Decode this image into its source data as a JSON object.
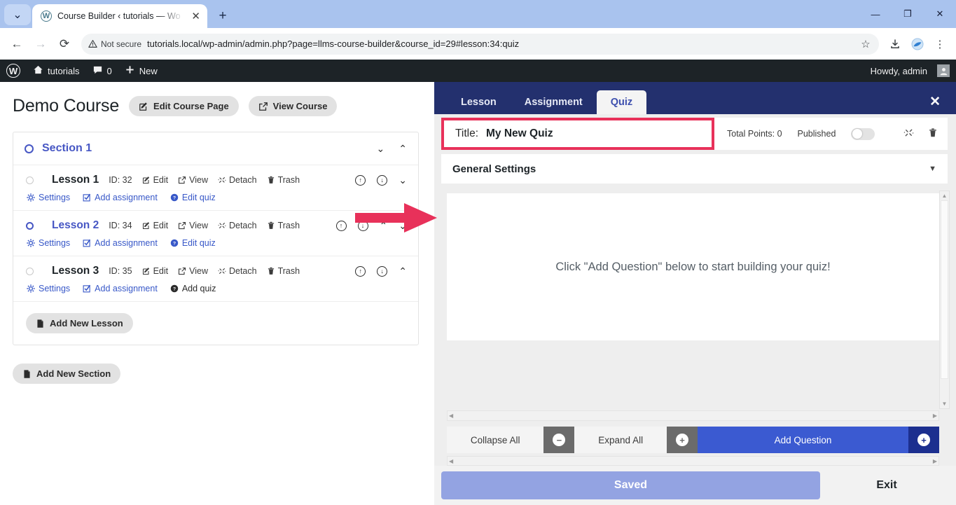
{
  "browser": {
    "tab": {
      "title": "Course Builder ‹ tutorials — Wo",
      "favicon": "wordpress-icon",
      "close": "✕"
    },
    "new_tab_label": "+",
    "tab_search": "⌄",
    "window_controls": {
      "minimize": "—",
      "maximize": "❐",
      "close": "✕"
    },
    "nav": {
      "back": "←",
      "forward": "→",
      "reload": "⟳"
    },
    "security_label": "Not secure",
    "url": "tutorials.local/wp-admin/admin.php?page=llms-course-builder&course_id=29#lesson:34:quiz",
    "toolbar_icons": {
      "bookmark": "☆",
      "downloads": "download-icon",
      "extension": "extension-icon",
      "menu": "⋮"
    }
  },
  "wp_adminbar": {
    "logo": "W",
    "site_name": "tutorials",
    "comments_count": "0",
    "new_label": "New",
    "howdy": "Howdy, admin"
  },
  "course": {
    "title": "Demo Course",
    "edit_course_page": "Edit Course Page",
    "view_course": "View Course",
    "add_new_section": "Add New Section",
    "add_new_lesson": "Add New Lesson",
    "section": {
      "name": "Section 1",
      "expand_icon": "⌄",
      "collapse_icon": "⌃"
    },
    "lessons": [
      {
        "name": "Lesson 1",
        "id_label": "ID: 32",
        "edit": "Edit",
        "view": "View",
        "detach": "Detach",
        "trash": "Trash",
        "settings": "Settings",
        "add_assignment": "Add assignment",
        "quiz_action": "Edit quiz",
        "active": false,
        "move_up": false,
        "move_down": true
      },
      {
        "name": "Lesson 2",
        "id_label": "ID: 34",
        "edit": "Edit",
        "view": "View",
        "detach": "Detach",
        "trash": "Trash",
        "settings": "Settings",
        "add_assignment": "Add assignment",
        "quiz_action": "Edit quiz",
        "active": true,
        "move_up": true,
        "move_down": true
      },
      {
        "name": "Lesson 3",
        "id_label": "ID: 35",
        "edit": "Edit",
        "view": "View",
        "detach": "Detach",
        "trash": "Trash",
        "settings": "Settings",
        "add_assignment": "Add assignment",
        "quiz_action": "Add quiz",
        "active": false,
        "move_up": true,
        "move_down": false
      }
    ]
  },
  "quiz_panel": {
    "tabs": [
      {
        "label": "Lesson",
        "active": false
      },
      {
        "label": "Assignment",
        "active": false
      },
      {
        "label": "Quiz",
        "active": true
      }
    ],
    "close": "✕",
    "title_label": "Title:",
    "title_value": "My New Quiz",
    "title_placeholder": "Quiz Title",
    "total_points": "Total Points: 0",
    "published_label": "Published",
    "published_on": false,
    "general_settings": "General Settings",
    "general_settings_caret": "▼",
    "empty_message": "Click \"Add Question\" below to start building your quiz!",
    "collapse_all": "Collapse All",
    "collapse_icon": "−",
    "expand_all": "Expand All",
    "expand_icon": "+",
    "add_question": "Add Question",
    "add_question_icon": "+",
    "saved": "Saved",
    "exit": "Exit"
  },
  "annotation": {
    "arrow_color": "#e8315a",
    "highlight_color": "#e8315a",
    "target": "quiz-title-field"
  },
  "colors": {
    "tab_bar": "#23306e",
    "accent_blue": "#3b5ad1",
    "link_blue": "#3858c8",
    "highlight_pink": "#e8315a",
    "saved_blue": "#93a3e2",
    "admin_bar": "#1d2327"
  }
}
